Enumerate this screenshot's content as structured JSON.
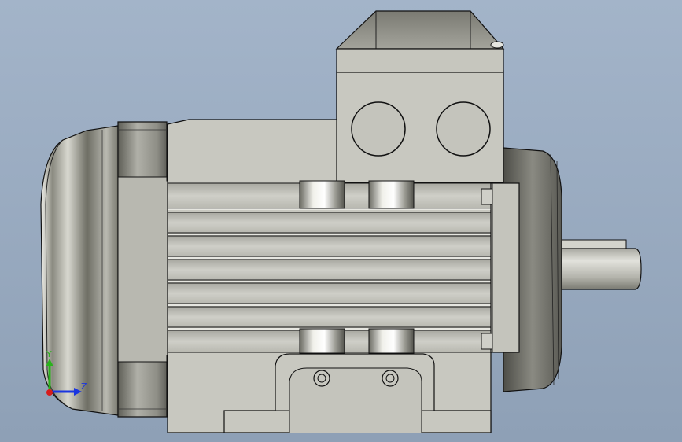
{
  "viewport": {
    "background_top": "#a3b4c9",
    "background_bottom": "#8ea0b6"
  },
  "triad": {
    "y_label": "Y",
    "z_label": "Z",
    "y_color": "#2ab21c",
    "z_color": "#1a35e0",
    "x_color": "#d81c1c"
  },
  "model": {
    "body_color": "#c8c8c0",
    "edge_color": "#111111",
    "fan_cover_icon": "fan-cover",
    "terminal_box_icon": "terminal-box",
    "shaft_icon": "shaft"
  }
}
